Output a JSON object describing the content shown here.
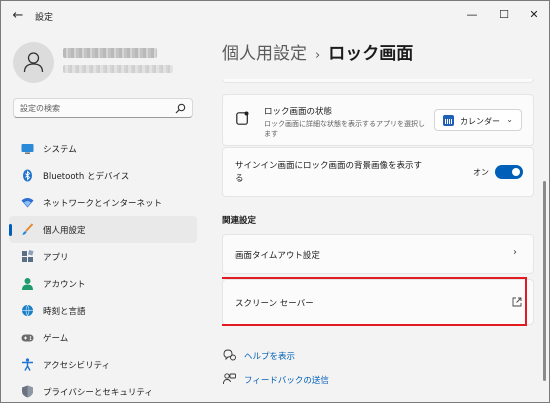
{
  "window": {
    "title": "設定"
  },
  "search": {
    "placeholder": "設定の検索"
  },
  "sidebar": {
    "items": [
      {
        "label": "システム",
        "icon": "monitor-icon",
        "color": "#2a8ad8"
      },
      {
        "label": "Bluetooth とデバイス",
        "icon": "bluetooth-icon",
        "color": "#1f73d1"
      },
      {
        "label": "ネットワークとインターネット",
        "icon": "wifi-icon",
        "color": "#2f6ed3"
      },
      {
        "label": "個人用設定",
        "icon": "brush-icon",
        "color": "#e08a32",
        "active": true
      },
      {
        "label": "アプリ",
        "icon": "apps-icon",
        "color": "#5b6f86"
      },
      {
        "label": "アカウント",
        "icon": "account-icon",
        "color": "#1d9b6b"
      },
      {
        "label": "時刻と言語",
        "icon": "globe-clock-icon",
        "color": "#1a7fc4"
      },
      {
        "label": "ゲーム",
        "icon": "gamepad-icon",
        "color": "#6b6b6b"
      },
      {
        "label": "アクセシビリティ",
        "icon": "accessibility-icon",
        "color": "#1f73d1"
      },
      {
        "label": "プライバシーとセキュリティ",
        "icon": "shield-icon",
        "color": "#6b7280"
      }
    ]
  },
  "header": {
    "parent": "個人用設定",
    "separator": "›",
    "current": "ロック画面"
  },
  "lock_status": {
    "title": "ロック画面の状態",
    "description": "ロック画面に詳細な状態を表示するアプリを選択します",
    "selected_app": "カレンダー"
  },
  "signin_bg": {
    "label": "サインイン画面にロック画面の背景画像を表示する",
    "state": "オン",
    "on": true
  },
  "related": {
    "title": "関連設定",
    "timeout_label": "画面タイムアウト設定",
    "saver_label": "スクリーン セーバー"
  },
  "links": {
    "help": "ヘルプを表示",
    "feedback": "フィードバックの送信"
  },
  "colors": {
    "accent": "#005fb8",
    "highlight": "#e21b23"
  }
}
